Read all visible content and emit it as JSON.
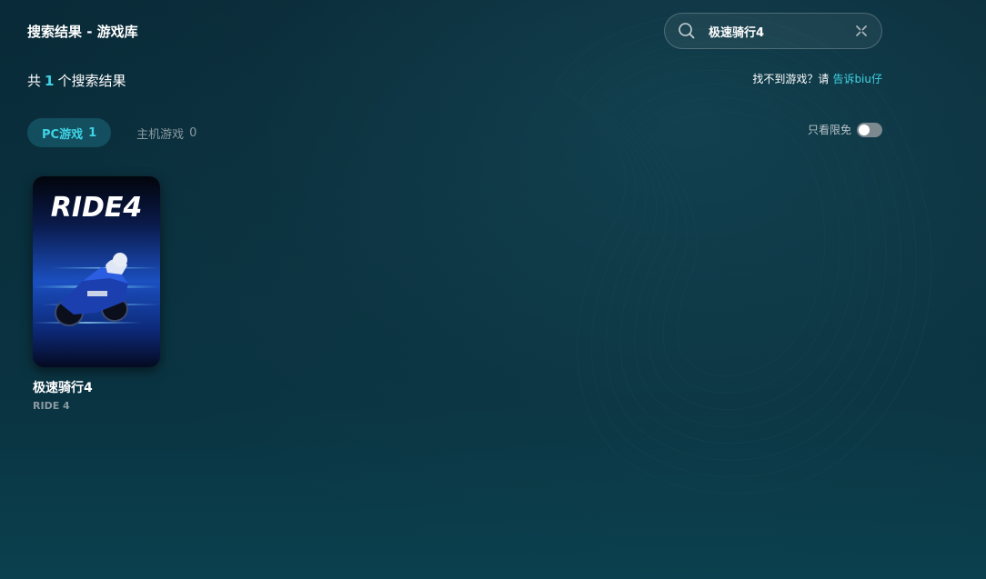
{
  "header": {
    "title": "搜索结果 - 游戏库"
  },
  "search": {
    "value": "极速骑行4"
  },
  "results": {
    "prefix": "共",
    "count": "1",
    "suffix": "个搜索结果"
  },
  "feedback": {
    "text": "找不到游戏？请",
    "link": "告诉biu仔"
  },
  "tabs": [
    {
      "label": "PC游戏",
      "count": "1",
      "active": true
    },
    {
      "label": "主机游戏",
      "count": "0",
      "active": false
    }
  ],
  "filter": {
    "label": "只看限免",
    "enabled": false
  },
  "games": [
    {
      "title": "极速骑行4",
      "subtitle": "RIDE 4",
      "cover_logo": "RIDE4"
    }
  ],
  "colors": {
    "accent": "#3fd4e6",
    "background": "#051820"
  }
}
